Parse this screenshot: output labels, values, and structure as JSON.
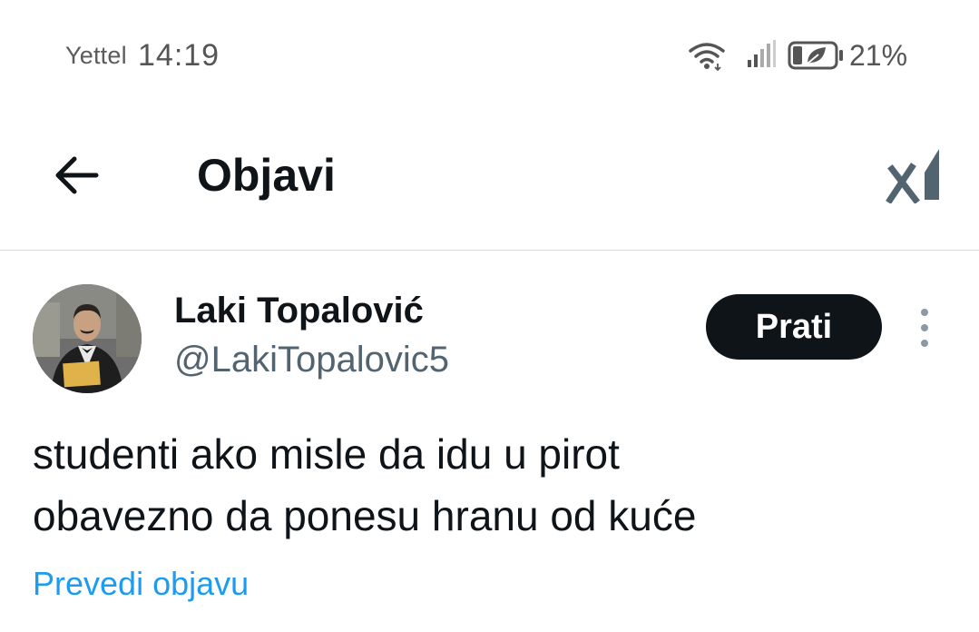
{
  "status_bar": {
    "carrier": "Yettel",
    "time": "14:19",
    "battery_percent": "21%",
    "icons": [
      "wifi-icon",
      "signal-icon",
      "battery-icon"
    ]
  },
  "header": {
    "title": "Objavi",
    "back_icon": "arrow-left-icon",
    "grok_icon": "grok-icon"
  },
  "tweet": {
    "author_name": "Laki Topalović",
    "author_handle": "@LakiTopalovic5",
    "follow_label": "Prati",
    "more_icon": "more-vertical-icon",
    "text_line1": "studenti ako misle da idu u pirot",
    "text_line2": "obavezno da ponesu hranu od kuće",
    "translate_label": "Prevedi objavu"
  },
  "colors": {
    "text_primary": "#0f1419",
    "text_secondary": "#536471",
    "link": "#1d9bf0",
    "follow_bg": "#0f1419",
    "divider": "#d8dde1"
  }
}
